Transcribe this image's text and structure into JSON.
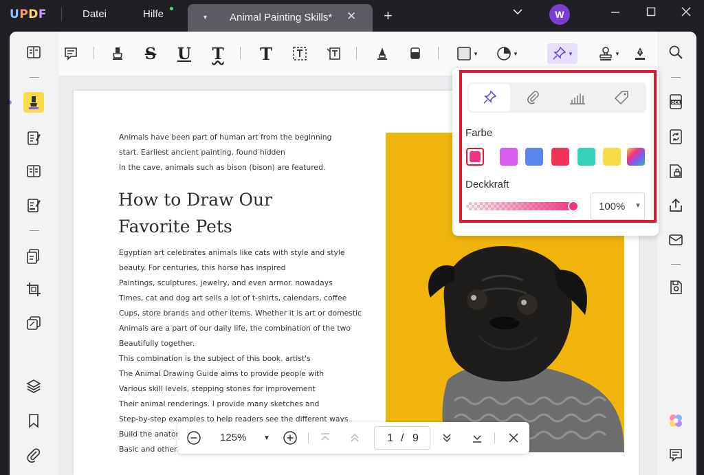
{
  "app": {
    "logo": {
      "u": "U",
      "p": "P",
      "d": "D",
      "f": "F"
    },
    "menu": {
      "file": "Datei",
      "help": "Hilfe"
    },
    "tab": {
      "title": "Animal Painting Skills*"
    },
    "avatar_initial": "W"
  },
  "document": {
    "intro_lines": [
      "Animals have been part of human art from the beginning",
      "start. Earliest ancient painting, found hidden",
      "In the cave, animals such as bison (bison) are featured."
    ],
    "heading_lines": [
      "How to Draw Our",
      "Favorite Pets"
    ],
    "body_lines": [
      "Egyptian art celebrates animals like cats with style and style",
      "beauty. For centuries, this horse has inspired",
      "Paintings, sculptures, jewelry, and even armor. nowadays",
      "Times, cat and dog art sells a lot of t-shirts, calendars, coffee",
      "Cups, store brands and other items. Whether it is art or domestic",
      "Animals are a part of our daily life, the combination of the two",
      "Beautifully together.",
      "This combination is the subject of this book. artist's",
      "The Animal Drawing Guide aims to provide people with",
      "Various skill levels, stepping stones for improvement",
      "Their animal renderings. I provide many sketches and",
      "Step-by-step examples to help readers see the different ways",
      "Build the anatomy of an animal. some are quite basic",
      "Basic and others are more advanced ones."
    ],
    "photo_bg": "#f0b40c"
  },
  "popover": {
    "color_label": "Farbe",
    "opacity_label": "Deckkraft",
    "opacity_value": "100%",
    "opacity_level": 1.0,
    "colors": [
      "#f0347f",
      "#d65cf0",
      "#5b86f0",
      "#f0345a",
      "#36d1b8",
      "#f7dc4a",
      "rainbow"
    ],
    "selected_color": "#f0347f"
  },
  "navbar": {
    "zoom": "125%",
    "current_page": "1",
    "separator": "/",
    "total_pages": "9"
  }
}
